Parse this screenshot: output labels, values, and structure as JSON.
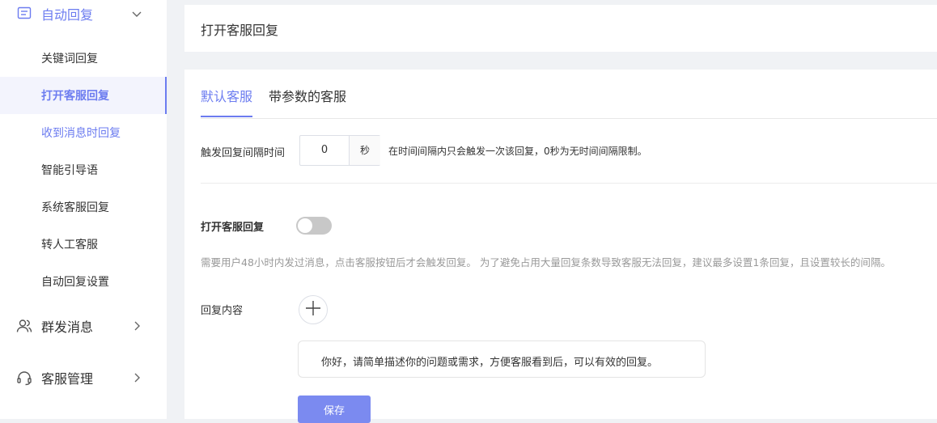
{
  "sidebar": {
    "auto_reply": {
      "label": "自动回复",
      "icon": "message-square-icon"
    },
    "items": [
      {
        "label": "关键词回复",
        "state": "normal"
      },
      {
        "label": "打开客服回复",
        "state": "selected"
      },
      {
        "label": "收到消息时回复",
        "state": "highlight"
      },
      {
        "label": "智能引导语",
        "state": "normal"
      },
      {
        "label": "系统客服回复",
        "state": "normal"
      },
      {
        "label": "转人工客服",
        "state": "normal"
      },
      {
        "label": "自动回复设置",
        "state": "normal"
      }
    ],
    "group_message": {
      "label": "群发消息",
      "icon": "users-icon"
    },
    "service_manage": {
      "label": "客服管理",
      "icon": "headset-icon"
    }
  },
  "header": {
    "title": "打开客服回复"
  },
  "tabs": [
    {
      "label": "默认客服",
      "active": true
    },
    {
      "label": "带参数的客服",
      "active": false
    }
  ],
  "interval": {
    "label": "触发回复间隔时间",
    "value": "0",
    "unit": "秒",
    "hint": "在时间间隔内只会触发一次该回复，0秒为无时间间隔限制。"
  },
  "toggle": {
    "label": "打开客服回复",
    "on": false
  },
  "note": "需要用户48小时内发过消息，点击客服按钮后才会触发回复。 为了避免占用大量回复条数导致客服无法回复，建议最多设置1条回复，且设置较长的间隔。",
  "reply": {
    "label": "回复内容",
    "content": "你好，请简单描述你的问题或需求，方便客服看到后，可以有效的回复。"
  },
  "save_label": "保存",
  "colors": {
    "accent": "#6c7cf0",
    "button": "#7b8af0",
    "switch_off": "#c8c8c8"
  }
}
